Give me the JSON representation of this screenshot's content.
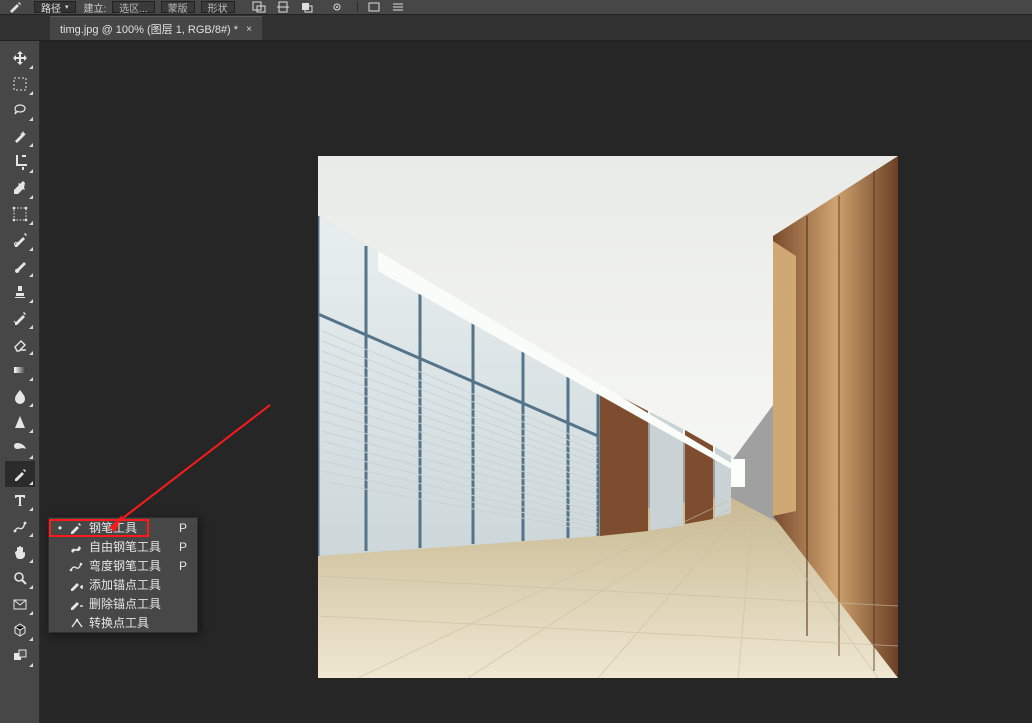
{
  "options_bar": {
    "path_label": "路径",
    "make_label": "建立:",
    "select_btn": "选区...",
    "mask_btn": "蒙版",
    "shape_btn": "形状"
  },
  "tab": {
    "title": "timg.jpg @ 100% (图层 1, RGB/8#) *"
  },
  "flyout": {
    "items": [
      {
        "label": "钢笔工具",
        "shortcut": "P",
        "checked": true,
        "icon": "pen"
      },
      {
        "label": "自由钢笔工具",
        "shortcut": "P",
        "checked": false,
        "icon": "freeform"
      },
      {
        "label": "弯度钢笔工具",
        "shortcut": "P",
        "checked": false,
        "icon": "curve"
      },
      {
        "label": "添加锚点工具",
        "shortcut": "",
        "checked": false,
        "icon": "addanchor"
      },
      {
        "label": "删除锚点工具",
        "shortcut": "",
        "checked": false,
        "icon": "delanchor"
      },
      {
        "label": "转换点工具",
        "shortcut": "",
        "checked": false,
        "icon": "convert"
      }
    ]
  },
  "tools": [
    "move",
    "marquee",
    "lasso",
    "magic",
    "crop",
    "eyedropper",
    "frame",
    "heal",
    "brush",
    "stamp",
    "history",
    "eraser",
    "gradient",
    "blur",
    "sharpen",
    "dodge",
    "pen",
    "type",
    "path",
    "hand",
    "zoom",
    "mail",
    "3d",
    "swatch"
  ]
}
